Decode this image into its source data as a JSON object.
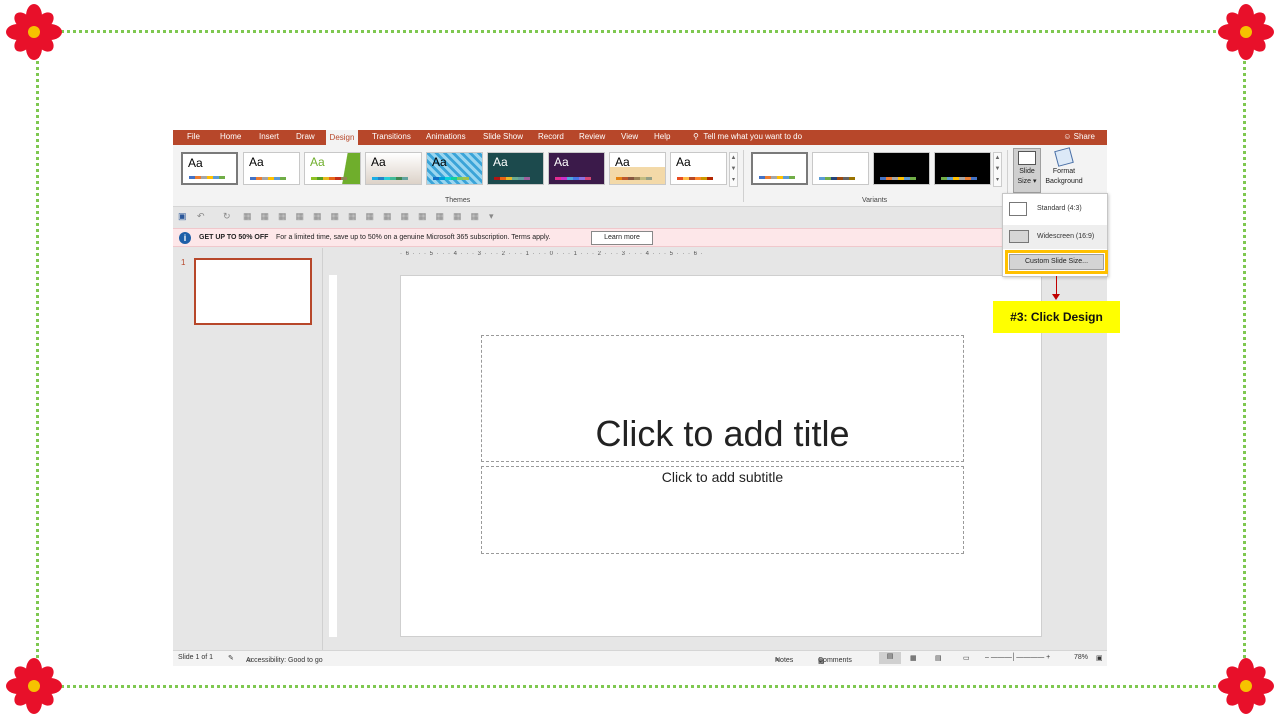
{
  "tabs": {
    "file": "File",
    "home": "Home",
    "insert": "Insert",
    "draw": "Draw",
    "design": "Design",
    "transitions": "Transitions",
    "animations": "Animations",
    "slideshow": "Slide Show",
    "record": "Record",
    "review": "Review",
    "view": "View",
    "help": "Help"
  },
  "tellme": "Tell me what you want to do",
  "share": "Share",
  "ribbon": {
    "theme_aa": "Aa",
    "themes_label": "Themes",
    "variants_label": "Variants",
    "slide_size_label_1": "Slide",
    "slide_size_label_2": "Size",
    "format_bg_label_1": "Format",
    "format_bg_label_2": "Background"
  },
  "message_bar": {
    "bold": "GET UP TO 50% OFF",
    "text": "For a limited time, save up to 50% on a genuine Microsoft 365 subscription. Terms apply.",
    "button": "Learn more"
  },
  "thumbnail": {
    "number": "1"
  },
  "ruler": {
    "marks": "· 6 · · · 5 · · · 4 · · · 3 · · · 2 · · · 1 · · · 0 · · · 1 · · · 2 · · · 3 · · · 4 · · · 5 · · · 6 ·"
  },
  "slide": {
    "title": "Click to add title",
    "subtitle": "Click to add subtitle"
  },
  "dropdown": {
    "standard": "Standard (4:3)",
    "widescreen": "Widescreen (16:9)",
    "custom": "Custom Slide Size..."
  },
  "callout": "#3: Click Design",
  "status": {
    "slide_of": "Slide 1 of 1",
    "accessibility": "Accessibility: Good to go",
    "notes": "Notes",
    "comments": "Comments",
    "zoom": "78%"
  },
  "colors": {
    "accent": "#b7472a",
    "highlight": "#ffc000",
    "callout_bg": "#ffff00",
    "arrow": "#c00000",
    "frame": "#7ec850"
  }
}
